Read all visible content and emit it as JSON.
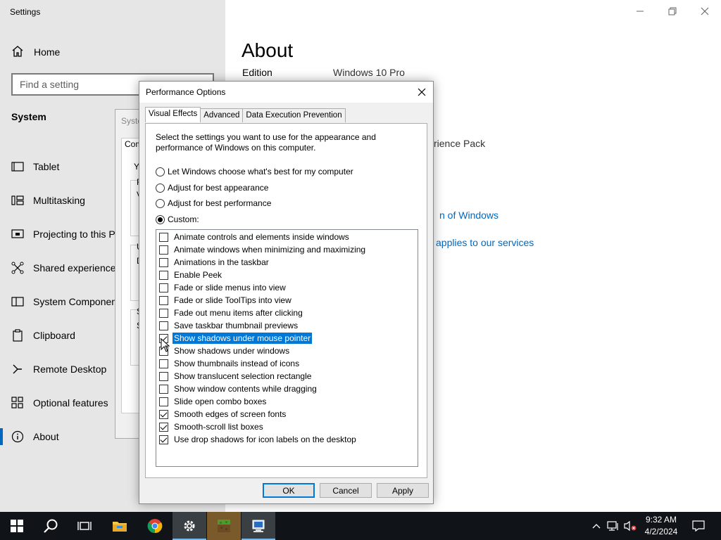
{
  "settings": {
    "title": "Settings",
    "home_label": "Home",
    "search_placeholder": "Find a setting",
    "section": "System",
    "nav": [
      {
        "label": "Tablet",
        "icon": "tablet-icon"
      },
      {
        "label": "Multitasking",
        "icon": "multitasking-icon"
      },
      {
        "label": "Projecting to this P",
        "icon": "projecting-icon"
      },
      {
        "label": "Shared experiences",
        "icon": "shared-experiences-icon"
      },
      {
        "label": "System Componen",
        "icon": "system-components-icon"
      },
      {
        "label": "Clipboard",
        "icon": "clipboard-icon"
      },
      {
        "label": "Remote Desktop",
        "icon": "remote-desktop-icon"
      },
      {
        "label": "Optional features",
        "icon": "optional-features-icon"
      },
      {
        "label": "About",
        "icon": "about-icon"
      }
    ],
    "page_title": "About",
    "edition_label": "Edition",
    "edition_value": "Windows 10 Pro",
    "experience_pack_fragment": "rience Pack",
    "link_windows_fragment": "n of Windows",
    "link_services_fragment": "applies to our services"
  },
  "system_properties": {
    "title_fragment": "Syste",
    "tab_fragment": "Com",
    "fragments": [
      "Yo",
      "F",
      "V",
      "U",
      "D",
      "S",
      "S"
    ]
  },
  "performance_options": {
    "title": "Performance Options",
    "tabs": [
      "Visual Effects",
      "Advanced",
      "Data Execution Prevention"
    ],
    "description": "Select the settings you want to use for the appearance and performance of Windows on this computer.",
    "radios": [
      {
        "label": "Let Windows choose what's best for my computer",
        "checked": false
      },
      {
        "label": "Adjust for best appearance",
        "checked": false
      },
      {
        "label": "Adjust for best performance",
        "checked": false
      },
      {
        "label": "Custom:",
        "checked": true
      }
    ],
    "options": [
      {
        "label": "Animate controls and elements inside windows",
        "checked": false
      },
      {
        "label": "Animate windows when minimizing and maximizing",
        "checked": false
      },
      {
        "label": "Animations in the taskbar",
        "checked": false
      },
      {
        "label": "Enable Peek",
        "checked": false
      },
      {
        "label": "Fade or slide menus into view",
        "checked": false
      },
      {
        "label": "Fade or slide ToolTips into view",
        "checked": false
      },
      {
        "label": "Fade out menu items after clicking",
        "checked": false
      },
      {
        "label": "Save taskbar thumbnail previews",
        "checked": false
      },
      {
        "label": "Show shadows under mouse pointer",
        "checked": true,
        "selected": true
      },
      {
        "label": "Show shadows under windows",
        "checked": false
      },
      {
        "label": "Show thumbnails instead of icons",
        "checked": false
      },
      {
        "label": "Show translucent selection rectangle",
        "checked": false
      },
      {
        "label": "Show window contents while dragging",
        "checked": false
      },
      {
        "label": "Slide open combo boxes",
        "checked": false
      },
      {
        "label": "Smooth edges of screen fonts",
        "checked": true
      },
      {
        "label": "Smooth-scroll list boxes",
        "checked": true
      },
      {
        "label": "Use drop shadows for icon labels on the desktop",
        "checked": true
      }
    ],
    "buttons": {
      "ok": "OK",
      "cancel": "Cancel",
      "apply": "Apply"
    }
  },
  "taskbar": {
    "apps": [
      "start-icon",
      "search-icon",
      "task-view-icon",
      "file-explorer-icon",
      "chrome-icon",
      "settings-icon",
      "minecraft-icon",
      "system-properties-icon"
    ],
    "time": "9:32 AM",
    "date": "4/2/2024"
  }
}
